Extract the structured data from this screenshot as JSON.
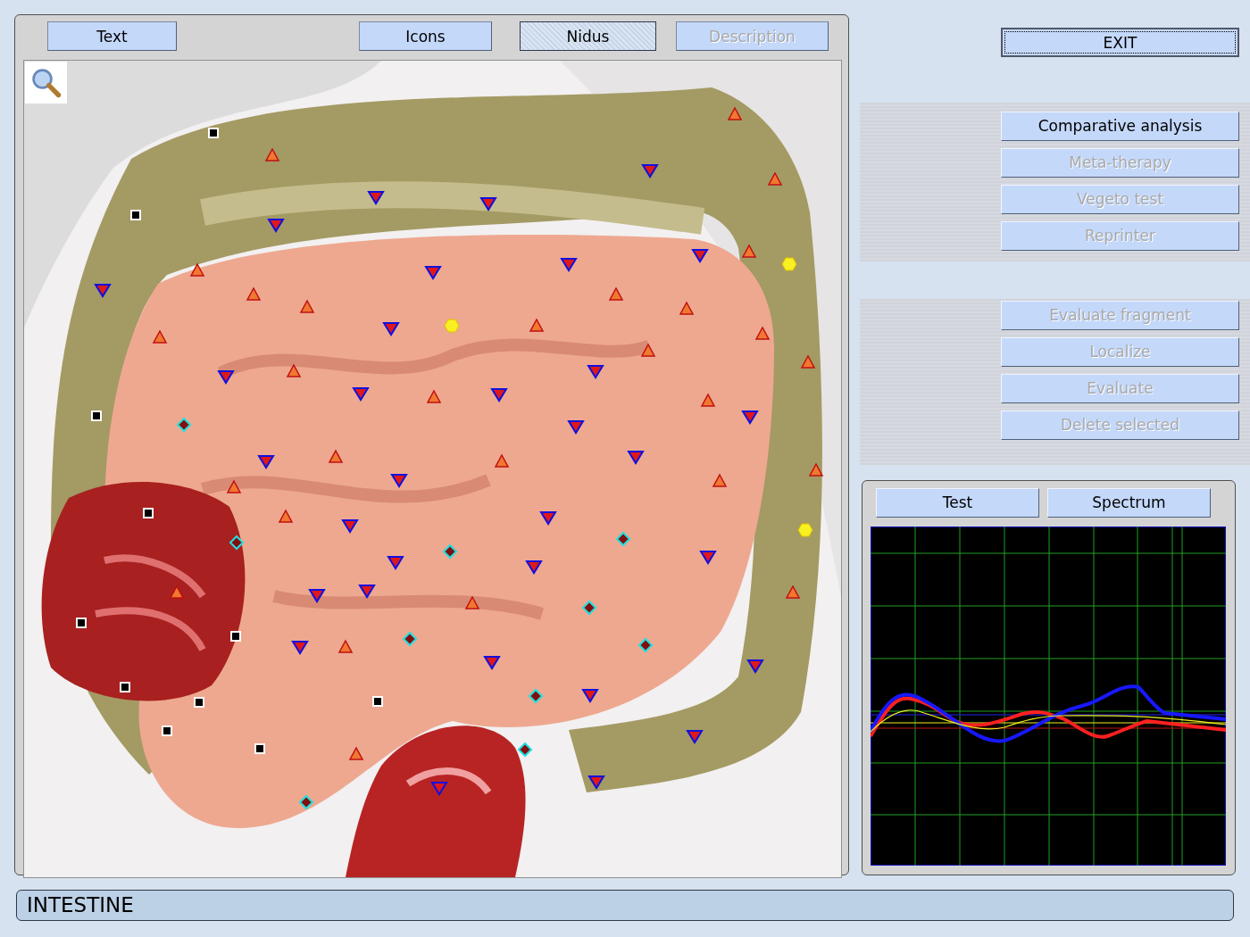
{
  "tabs": [
    {
      "label": "Text",
      "selected": false,
      "disabled": false
    },
    {
      "label": "Icons",
      "selected": false,
      "disabled": false
    },
    {
      "label": "Nidus",
      "selected": true,
      "disabled": false
    },
    {
      "label": "Description",
      "selected": false,
      "disabled": true
    }
  ],
  "exit_button": "EXIT",
  "analysis_buttons": [
    {
      "label": "Comparative analysis",
      "disabled": false
    },
    {
      "label": "Meta-therapy",
      "disabled": true
    },
    {
      "label": "Vegeto test",
      "disabled": true
    },
    {
      "label": "Reprinter",
      "disabled": true
    }
  ],
  "evaluation_buttons": [
    {
      "label": "Evaluate fragment",
      "disabled": true
    },
    {
      "label": "Localize",
      "disabled": true
    },
    {
      "label": "Evaluate",
      "disabled": true
    },
    {
      "label": "Delete selected",
      "disabled": true
    }
  ],
  "graph_tabs": [
    {
      "label": "Test"
    },
    {
      "label": "Spectrum"
    }
  ],
  "status_bar": "INTESTINE"
}
